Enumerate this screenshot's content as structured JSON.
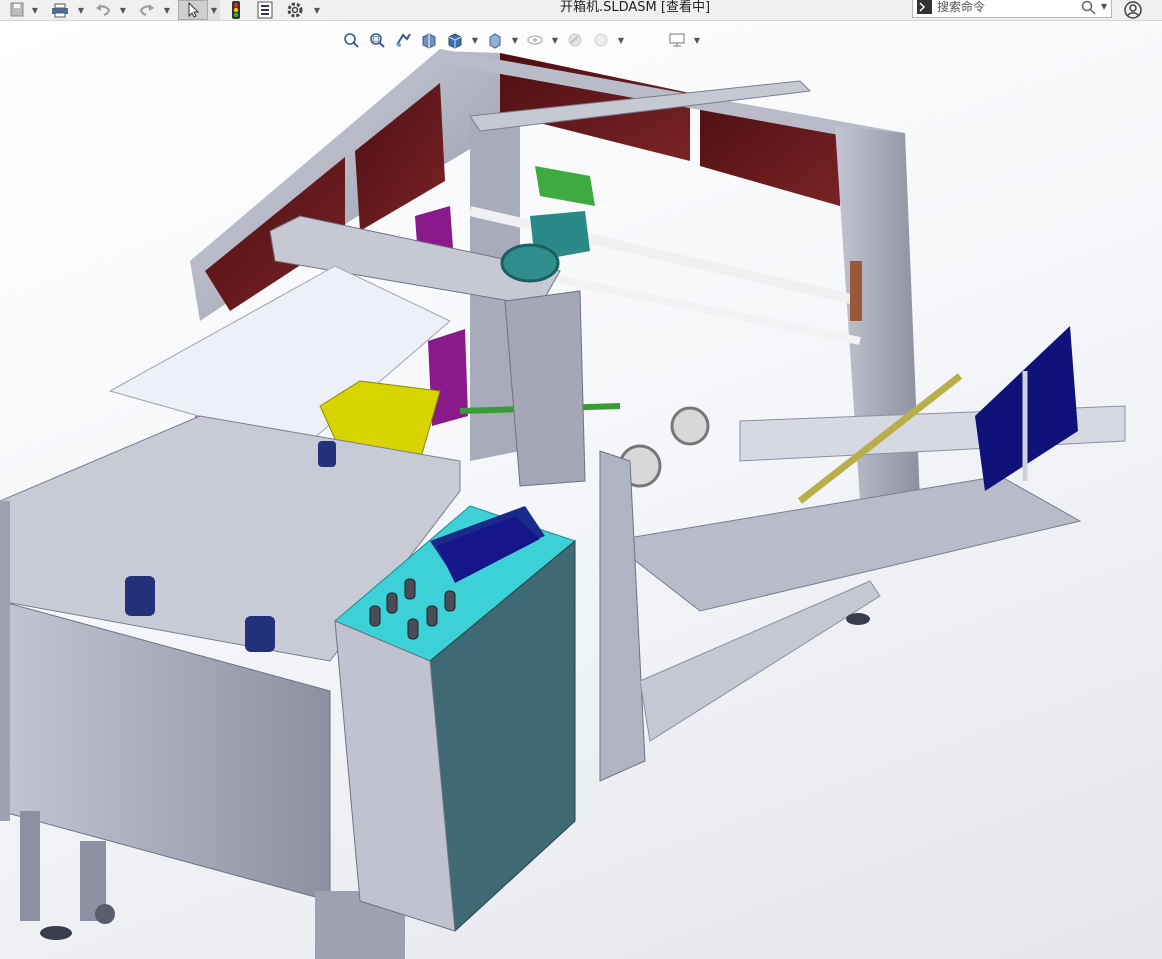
{
  "window": {
    "title": "开箱机.SLDASM [查看中]"
  },
  "toolbar": {
    "icons": [
      "save-icon",
      "print-icon",
      "undo-icon",
      "redo-icon",
      "select-cursor-icon",
      "rebuild-traffic-light-icon",
      "file-properties-icon",
      "options-gear-icon"
    ]
  },
  "search": {
    "placeholder": "搜索命令"
  },
  "heads_up_view": {
    "icons": [
      "zoom-to-fit-icon",
      "zoom-to-area-icon",
      "previous-view-icon",
      "section-view-icon",
      "view-orientation-icon",
      "display-style-icon",
      "hide-show-icon",
      "appearance-icon",
      "scene-icon",
      "view-settings-icon"
    ]
  },
  "model": {
    "name": "开箱机",
    "colors": {
      "frame": "#9598a8",
      "frame_light": "#c9cbd6",
      "panel_red": "#6a1a1c",
      "panel_magenta": "#8a1a8c",
      "teal_panel": "#3f6a73",
      "cyan_top": "#3bd1d6",
      "screen_blue": "#17158a",
      "yellow_bracket": "#d7d400",
      "green_arm": "#3a9a3a",
      "blue_flap": "#10127a",
      "gold_rod": "#b8ae4a",
      "motor_blue": "#23307a"
    }
  }
}
